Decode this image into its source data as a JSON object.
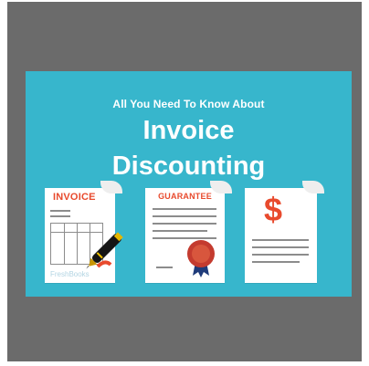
{
  "banner": {
    "kicker": "All You Need To Know About",
    "title_line1": "Invoice",
    "title_line2": "Discounting"
  },
  "docs": {
    "invoice": {
      "label": "INVOICE",
      "brand": "FreshBooks"
    },
    "guarantee": {
      "label": "GUARANTEE"
    },
    "dollar": {
      "symbol": "$"
    }
  },
  "colors": {
    "frame": "#6b6b6b",
    "banner": "#37b6cc",
    "accent": "#e84a2d",
    "text": "#ffffff"
  },
  "icons": [
    "pen-icon",
    "seal-icon",
    "document-icon"
  ]
}
